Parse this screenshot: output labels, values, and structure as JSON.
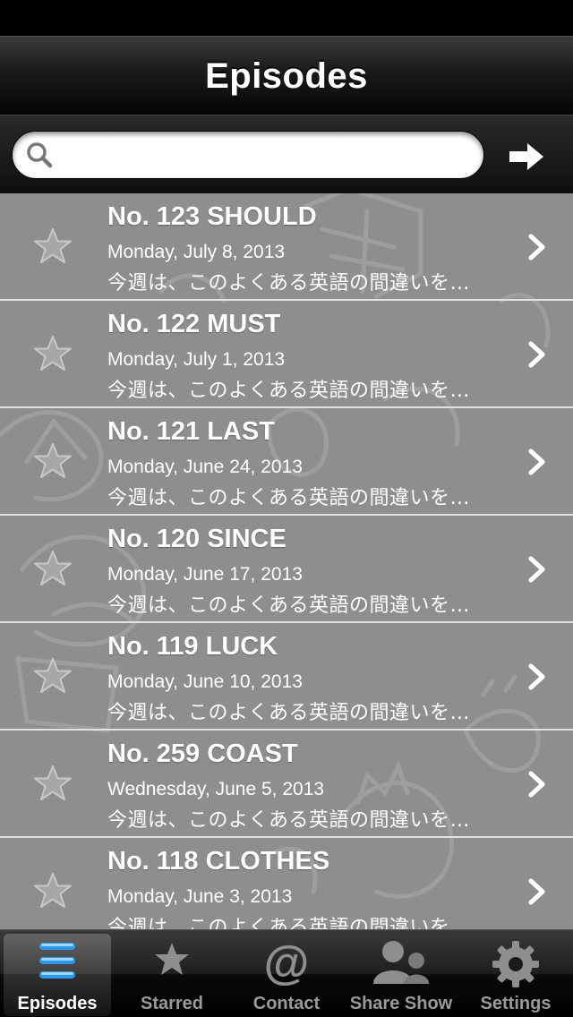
{
  "nav": {
    "title": "Episodes"
  },
  "search": {
    "placeholder": "",
    "value": ""
  },
  "episodes": [
    {
      "title": "No. 123 SHOULD",
      "date": "Monday, July 8, 2013",
      "description": "今週は、このよくある英語の間違いを…",
      "starred": false
    },
    {
      "title": "No. 122 MUST",
      "date": "Monday, July 1, 2013",
      "description": "今週は、このよくある英語の間違いを…",
      "starred": false
    },
    {
      "title": "No. 121 LAST",
      "date": "Monday, June 24, 2013",
      "description": "今週は、このよくある英語の間違いを…",
      "starred": false
    },
    {
      "title": "No. 120 SINCE",
      "date": "Monday, June 17, 2013",
      "description": "今週は、このよくある英語の間違いを…",
      "starred": false
    },
    {
      "title": "No. 119 LUCK",
      "date": "Monday, June 10, 2013",
      "description": "今週は、このよくある英語の間違いを…",
      "starred": false
    },
    {
      "title": "No. 259 COAST",
      "date": "Wednesday, June 5, 2013",
      "description": "今週は、このよくある英語の間違いを…",
      "starred": false
    },
    {
      "title": "No. 118 CLOTHES",
      "date": "Monday, June 3, 2013",
      "description": "今週は、このよくある英語の間違いを…",
      "starred": false
    }
  ],
  "tabs": [
    {
      "label": "Episodes",
      "icon": "list-icon",
      "selected": true
    },
    {
      "label": "Starred",
      "icon": "star-icon",
      "selected": false
    },
    {
      "label": "Contact",
      "icon": "at-sign-icon",
      "selected": false
    },
    {
      "label": "Share Show",
      "icon": "people-icon",
      "selected": false
    },
    {
      "label": "Settings",
      "icon": "gear-icon",
      "selected": false
    }
  ],
  "colors": {
    "nav_bg": "#1a1a1a",
    "row_bg": "#8c8c8c",
    "separator": "#e2e2e2",
    "selected_tab": "#ffffff"
  }
}
